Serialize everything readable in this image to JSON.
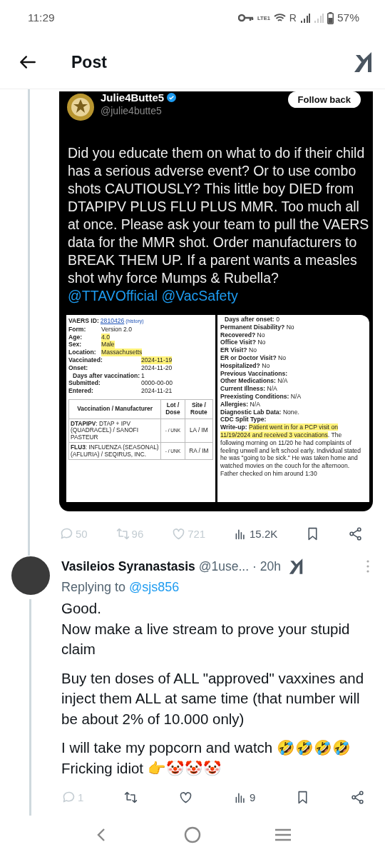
{
  "status_bar": {
    "time": "11:29",
    "network_type": "LTE1",
    "roaming": "R",
    "battery": "57%"
  },
  "header": {
    "title": "Post"
  },
  "quoted_post": {
    "author": "Julie4Butte5",
    "verified": true,
    "handle": "@julie4butte5",
    "follow_button": "Follow back",
    "text": "Did you educate them on what to do if their child has a serious adverse event? Or to use combo shots CAUTIOUSLY? This little boy DIED from DTAPIPV PLUS FLU PLUS MMR. Too much all at once. Please ask your team to pull the VAERS data for the MMR shot. Order manufacturers to BREAK THEM UP. If a parent wants a measles shot why force Mumps & Rubella?",
    "mentions": [
      "@TTAVOfficial",
      "@VacSafety"
    ],
    "report": {
      "id_label": "VAERS ID:",
      "id": "2810426",
      "history": "(history)",
      "fields": [
        {
          "label": "Form:",
          "value": "Version 2.0",
          "highlighted": false,
          "kind": "short"
        },
        {
          "label": "Age:",
          "value": "4.0",
          "highlighted": true,
          "kind": "short"
        },
        {
          "label": "Sex:",
          "value": "Male",
          "highlighted": true,
          "kind": "short"
        },
        {
          "label": "Location:",
          "value": "Massachusetts",
          "highlighted": true,
          "kind": "short"
        },
        {
          "label": "Vaccinated:",
          "value": "2024-11-19",
          "highlighted": true,
          "kind": "long"
        },
        {
          "label": "Onset:",
          "value": "2024-11-20",
          "highlighted": false,
          "kind": "long"
        },
        {
          "label": "Days after vaccination:",
          "value": "1",
          "highlighted": false,
          "kind": "inline"
        },
        {
          "label": "Submitted:",
          "value": "0000-00-00",
          "highlighted": false,
          "kind": "long"
        },
        {
          "label": "Entered:",
          "value": "2024-11-21",
          "highlighted": false,
          "kind": "long"
        }
      ],
      "table": {
        "columns": [
          "Vaccination / Manufacturer",
          "Lot / Dose",
          "Site / Route"
        ],
        "rows": [
          {
            "code": "DTAPIPV",
            "name": ": DTAP + IPV (QUADRACEL) / SANOFI PASTEUR",
            "dose": "- / UNK",
            "route": "LA / IM"
          },
          {
            "code": "FLU3",
            "name": ": INFLUENZA (SEASONAL) (AFLURIA) / SEQIRUS, INC.",
            "dose": "- / UNK",
            "route": "RA / IM"
          }
        ]
      },
      "details": [
        {
          "label": "Days after onset:",
          "value": "0",
          "kind": "indented"
        },
        {
          "label": "Permanent Disability?",
          "value": "No",
          "kind": "plain"
        },
        {
          "label": "Recovered?",
          "value": "No",
          "kind": "plain"
        },
        {
          "label": "Office Visit?",
          "value": "No",
          "kind": "plain"
        },
        {
          "label": "ER Visit?",
          "value": "No",
          "kind": "plain"
        },
        {
          "label": "ER or Doctor Visit?",
          "value": "No",
          "kind": "plain"
        },
        {
          "label": "Hospitalized?",
          "value": "No",
          "kind": "plain"
        },
        {
          "label": "Previous Vaccinations:",
          "kind": "plain"
        },
        {
          "label": "Other Medications:",
          "value": "N/A",
          "kind": "plain"
        },
        {
          "label": "Current Illness:",
          "value": "N/A",
          "kind": "plain"
        },
        {
          "label": "Preexisting Conditions:",
          "value": "N/A",
          "kind": "plain"
        },
        {
          "label": "Allergies:",
          "value": "N/A",
          "kind": "plain"
        },
        {
          "label": "Diagnostic Lab Data:",
          "value": "None.",
          "kind": "plain"
        },
        {
          "label": "CDC Split Type:",
          "kind": "plain"
        }
      ],
      "writeup": {
        "label": "Write-up:",
        "parts": [
          {
            "text": "Patient went in for a PCP visit on 11/19/2024 and received 3 vaccinations",
            "highlighted": true
          },
          {
            "text": ". The following morning on 11/20 he had complaints of feeling unwell and left school early. Individual stated he was \"going to be sick.\" He was taken home and watched movies on the couch for the afternoon. Father checked on him around 1:30",
            "highlighted": false
          }
        ]
      }
    }
  },
  "post_actions": [
    {
      "kind": "reply",
      "count": "50",
      "dimmed": true
    },
    {
      "kind": "repost",
      "count": "96",
      "dimmed": true
    },
    {
      "kind": "like",
      "count": "721",
      "dimmed": true
    },
    {
      "kind": "views",
      "count": "15.2K",
      "dimmed": false
    },
    {
      "kind": "bookmark",
      "dimmed": false
    },
    {
      "kind": "share",
      "dimmed": false
    }
  ],
  "reply": {
    "author": "Vasileios Syranastasis",
    "handle": "@1use...",
    "time": "· 20h",
    "replying_label": "Replying to",
    "replying_to": "@sjs856",
    "paragraphs": [
      [
        "Good.",
        "Now make a live stream to prove your stupid claim"
      ],
      [
        "Buy ten doses of ALL \"approved\" vaxxines and inject them ALL at same time (that number will be about 2% of 10.000 only)"
      ],
      [
        "I will take my popcorn and watch 🤣🤣🤣🤣",
        "Fricking idiot 👉🤡🤡🤡"
      ]
    ],
    "actions": [
      {
        "kind": "reply",
        "count": "1",
        "dimmed": true
      },
      {
        "kind": "repost",
        "dimmed": false
      },
      {
        "kind": "like",
        "dimmed": false
      },
      {
        "kind": "views",
        "count": "9",
        "dimmed": false
      },
      {
        "kind": "bookmark",
        "dimmed": false
      },
      {
        "kind": "share",
        "dimmed": false
      }
    ]
  }
}
